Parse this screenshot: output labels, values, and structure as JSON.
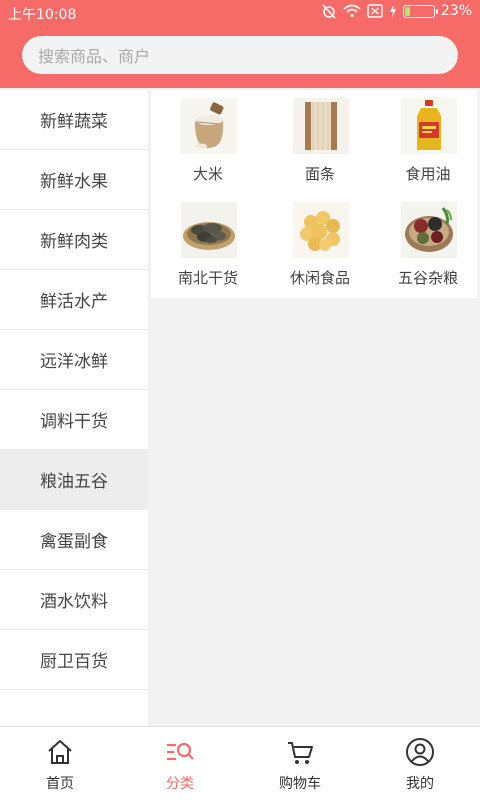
{
  "status": {
    "time": "上午10:08",
    "battery": "23%",
    "battery_level": 0.23
  },
  "search": {
    "placeholder": "搜索商品、商户"
  },
  "sidebar": {
    "items": [
      {
        "label": "新鲜蔬菜"
      },
      {
        "label": "新鲜水果"
      },
      {
        "label": "新鲜肉类"
      },
      {
        "label": "鲜活水产"
      },
      {
        "label": "远洋冰鲜"
      },
      {
        "label": "调料干货"
      },
      {
        "label": "粮油五谷",
        "active": true
      },
      {
        "label": "禽蛋副食"
      },
      {
        "label": "酒水饮料"
      },
      {
        "label": "厨卫百货"
      }
    ]
  },
  "products": [
    {
      "label": "大米",
      "icon": "rice-sack-icon"
    },
    {
      "label": "面条",
      "icon": "noodles-icon"
    },
    {
      "label": "食用油",
      "icon": "cooking-oil-icon"
    },
    {
      "label": "南北干货",
      "icon": "dried-mushroom-icon"
    },
    {
      "label": "休闲食品",
      "icon": "snack-icon"
    },
    {
      "label": "五谷杂粮",
      "icon": "grains-icon"
    }
  ],
  "tabbar": {
    "items": [
      {
        "label": "首页",
        "icon": "home-icon"
      },
      {
        "label": "分类",
        "icon": "category-icon",
        "active": true
      },
      {
        "label": "购物车",
        "icon": "cart-icon"
      },
      {
        "label": "我的",
        "icon": "profile-icon"
      }
    ]
  },
  "colors": {
    "accent": "#f66b68",
    "battery": "#a6f06a"
  }
}
